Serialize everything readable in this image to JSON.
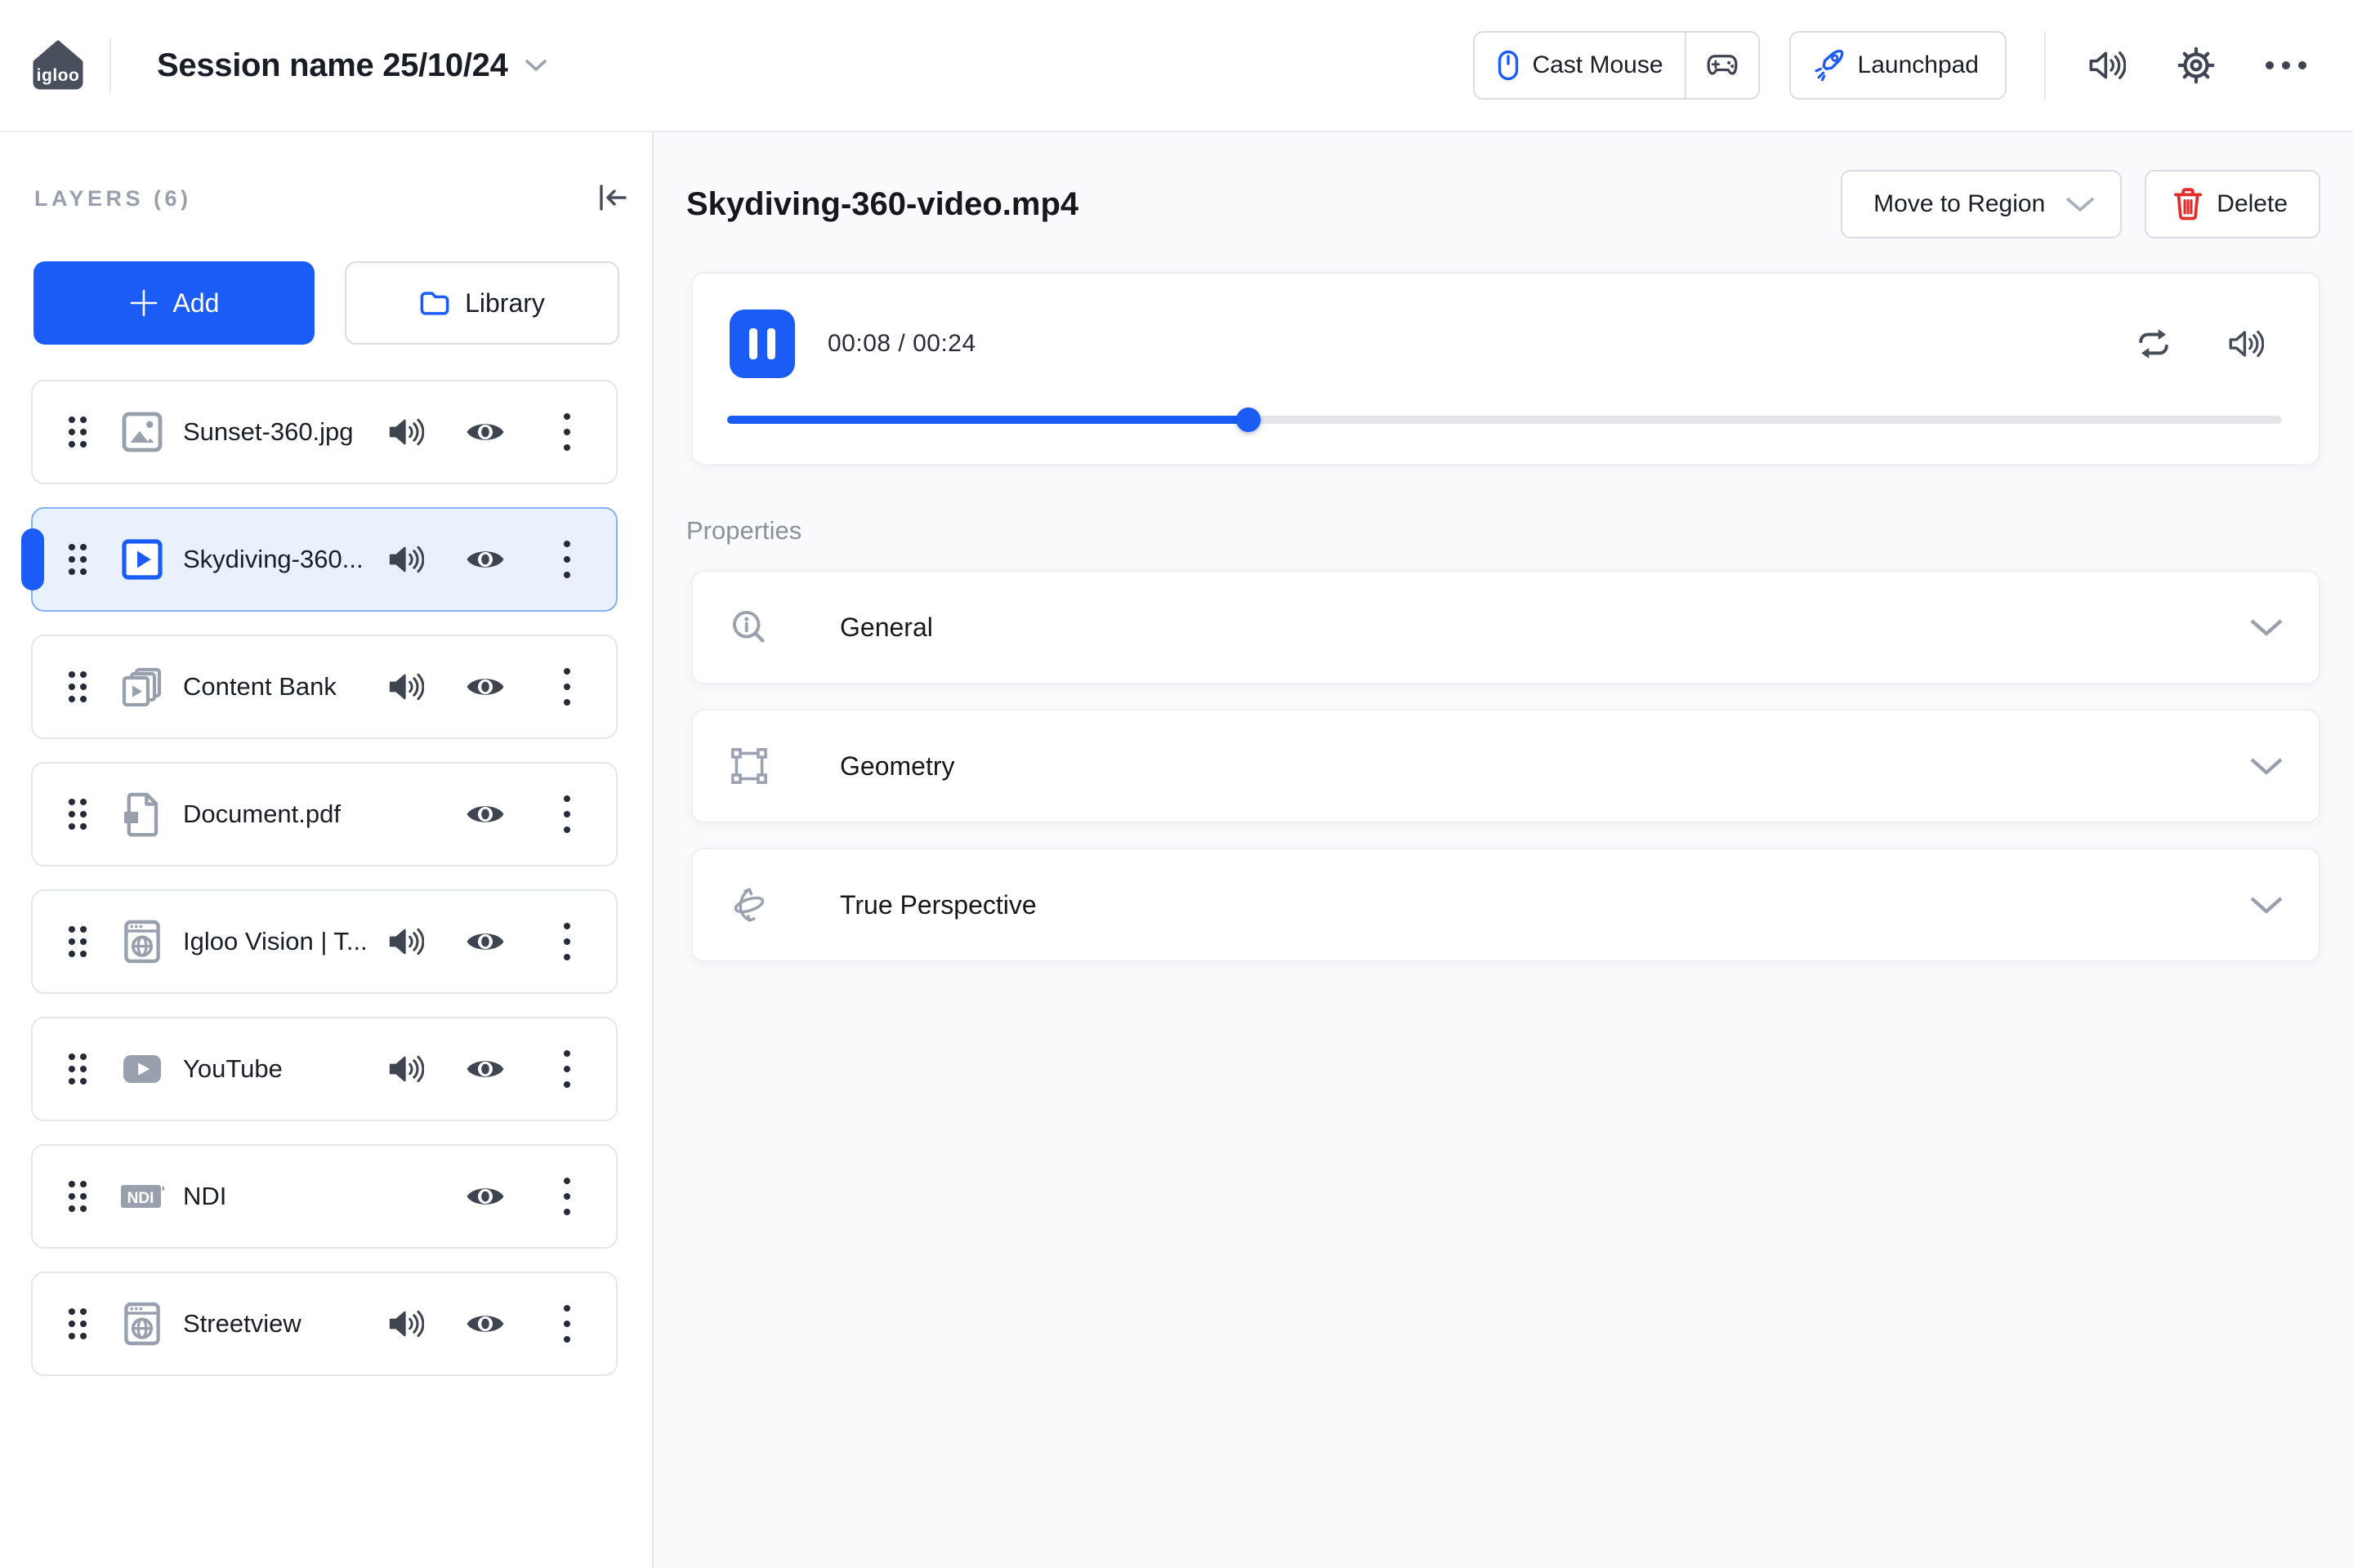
{
  "topbar": {
    "logo_text": "igloo",
    "session_title": "Session name 25/10/24",
    "cast_mouse_label": "Cast Mouse",
    "launchpad_label": "Launchpad",
    "icons": [
      "mouse-icon",
      "gamepad-icon",
      "rocket-icon",
      "volume-icon",
      "gear-icon",
      "ellipsis-icon"
    ]
  },
  "sidebar": {
    "header": "LAYERS (6)",
    "add_label": "Add",
    "library_label": "Library",
    "collapse_icon": "collapse-left-icon",
    "layers": [
      {
        "name": "Sunset-360.jpg",
        "icon": "image-icon",
        "has_audio": true,
        "selected": false
      },
      {
        "name": "Skydiving-360...",
        "icon": "video-icon",
        "has_audio": true,
        "selected": true
      },
      {
        "name": "Content Bank",
        "icon": "content-bank-icon",
        "has_audio": true,
        "selected": false
      },
      {
        "name": "Document.pdf",
        "icon": "document-icon",
        "has_audio": false,
        "selected": false
      },
      {
        "name": "Igloo Vision | T...",
        "icon": "web-icon",
        "has_audio": true,
        "selected": false
      },
      {
        "name": "YouTube",
        "icon": "youtube-icon",
        "has_audio": true,
        "selected": false
      },
      {
        "name": "NDI",
        "icon": "ndi-icon",
        "has_audio": false,
        "selected": false
      },
      {
        "name": "Streetview",
        "icon": "web-icon",
        "has_audio": true,
        "selected": false
      }
    ]
  },
  "main": {
    "title": "Skydiving-360-video.mp4",
    "move_to_region_label": "Move to Region",
    "delete_label": "Delete",
    "player": {
      "state": "playing",
      "time_display": "00:08 / 00:24",
      "time_current": "00:08",
      "time_total": "00:24",
      "progress_percent": 33.5,
      "icons": [
        "pause-icon",
        "repeat-icon",
        "volume-icon"
      ]
    },
    "properties": {
      "label": "Properties",
      "sections": [
        {
          "label": "General",
          "icon": "info-icon"
        },
        {
          "label": "Geometry",
          "icon": "geometry-icon"
        },
        {
          "label": "True Perspective",
          "icon": "rotate-3d-icon"
        }
      ]
    }
  },
  "colors": {
    "brand_blue": "#1A5CF5",
    "selected_bg": "#E9F1FD",
    "selected_border": "#82B1F8",
    "danger_red": "#E22B2B",
    "text_dark": "#191D26",
    "text_gray": "#99A0AB",
    "icon_dark": "#3E4450",
    "icon_gray": "#98A0AD",
    "main_bg": "#F9FAFB",
    "border": "#E4E7EC"
  }
}
